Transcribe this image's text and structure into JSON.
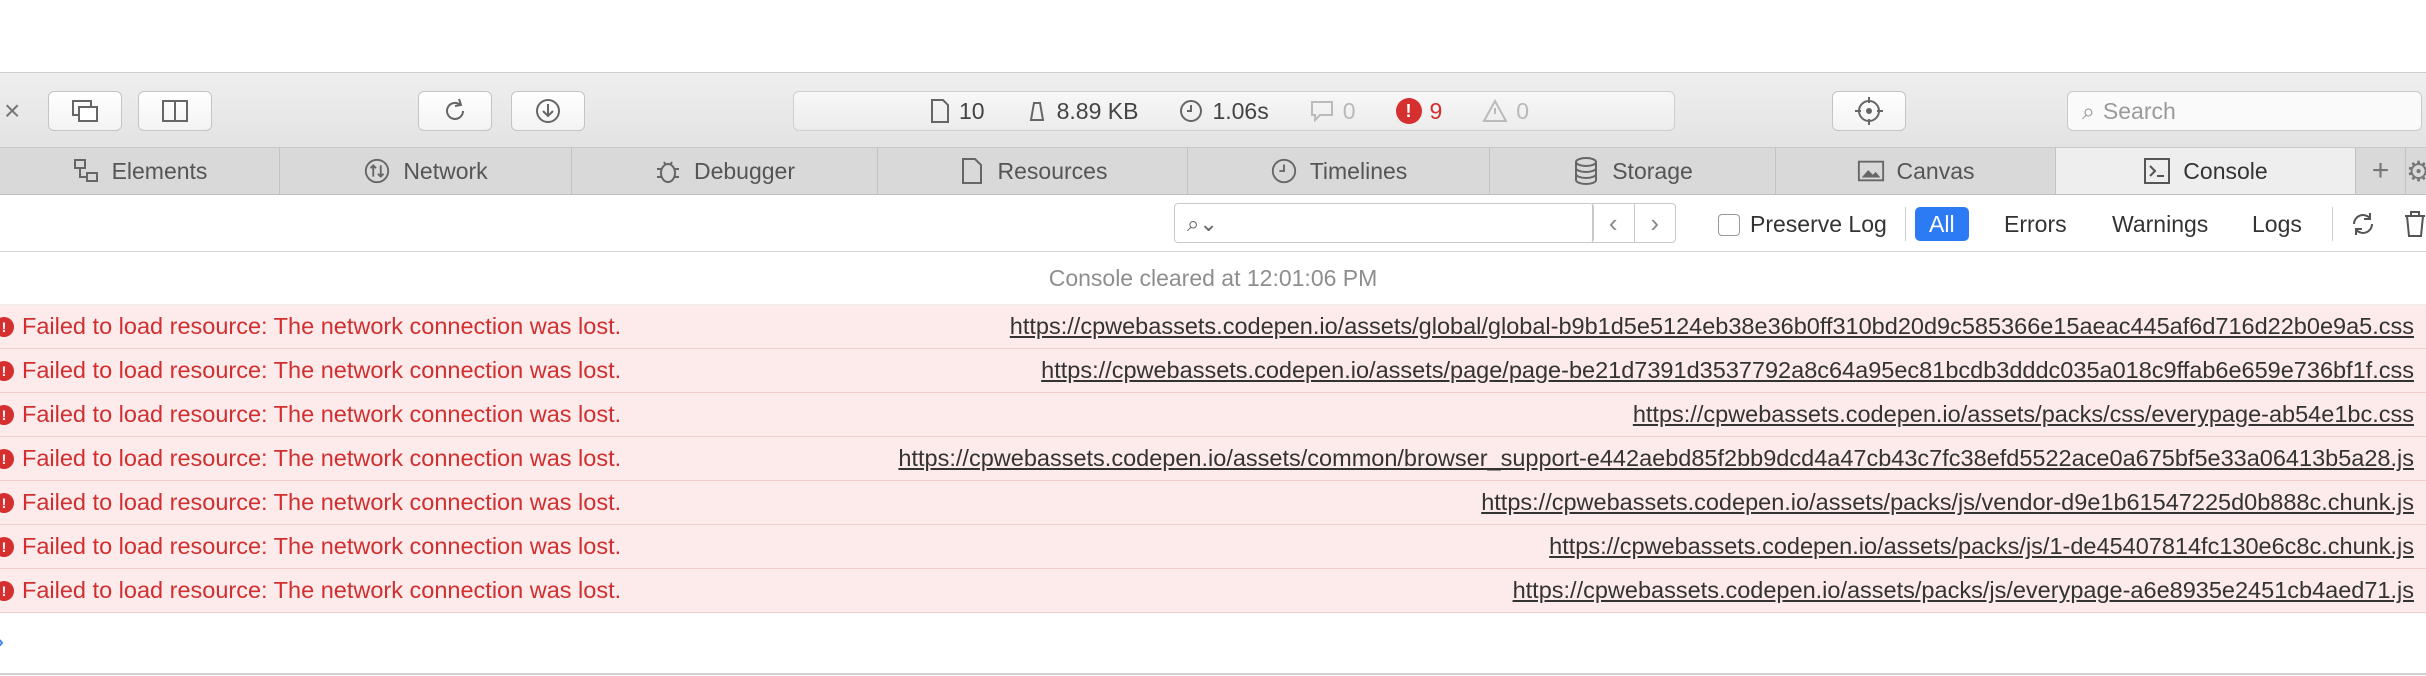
{
  "toolbar": {
    "close_label": "×",
    "activity": {
      "resources": "10",
      "size": "8.89 KB",
      "load_time": "1.06s",
      "logs_count": "0",
      "errors_count": "9",
      "warnings_count": "0"
    },
    "search_placeholder": "Search"
  },
  "tabs": [
    {
      "label": "Elements",
      "icon": "elements-icon"
    },
    {
      "label": "Network",
      "icon": "network-icon"
    },
    {
      "label": "Debugger",
      "icon": "debugger-icon"
    },
    {
      "label": "Resources",
      "icon": "resources-icon"
    },
    {
      "label": "Timelines",
      "icon": "timelines-icon"
    },
    {
      "label": "Storage",
      "icon": "storage-icon"
    },
    {
      "label": "Canvas",
      "icon": "canvas-icon"
    },
    {
      "label": "Console",
      "icon": "console-icon",
      "active": true
    }
  ],
  "filter": {
    "preserve_log_label": "Preserve Log",
    "levels": [
      "All",
      "Errors",
      "Warnings",
      "Logs"
    ],
    "active_level": "All"
  },
  "console": {
    "cleared_text": "Console cleared at 12:01:06 PM",
    "messages": [
      {
        "text": "Failed to load resource: The network connection was lost.",
        "url": "https://cpwebassets.codepen.io/assets/global/global-b9b1d5e5124eb38e36b0ff310bd20d9c585366e15aeac445af6d716d22b0e9a5.css"
      },
      {
        "text": "Failed to load resource: The network connection was lost.",
        "url": "https://cpwebassets.codepen.io/assets/page/page-be21d7391d3537792a8c64a95ec81bcdb3dddc035a018c9ffab6e659e736bf1f.css"
      },
      {
        "text": "Failed to load resource: The network connection was lost.",
        "url": "https://cpwebassets.codepen.io/assets/packs/css/everypage-ab54e1bc.css"
      },
      {
        "text": "Failed to load resource: The network connection was lost.",
        "url": "https://cpwebassets.codepen.io/assets/common/browser_support-e442aebd85f2bb9dcd4a47cb43c7fc38efd5522ace0a675bf5e33a06413b5a28.js"
      },
      {
        "text": "Failed to load resource: The network connection was lost.",
        "url": "https://cpwebassets.codepen.io/assets/packs/js/vendor-d9e1b61547225d0b888c.chunk.js"
      },
      {
        "text": "Failed to load resource: The network connection was lost.",
        "url": "https://cpwebassets.codepen.io/assets/packs/js/1-de45407814fc130e6c8c.chunk.js"
      },
      {
        "text": "Failed to load resource: The network connection was lost.",
        "url": "https://cpwebassets.codepen.io/assets/packs/js/everypage-a6e8935e2451cb4aed71.js"
      }
    ]
  },
  "colors": {
    "error_text": "#d12f2f",
    "error_bg": "#fdeaea",
    "accent": "#2d7bf4"
  }
}
